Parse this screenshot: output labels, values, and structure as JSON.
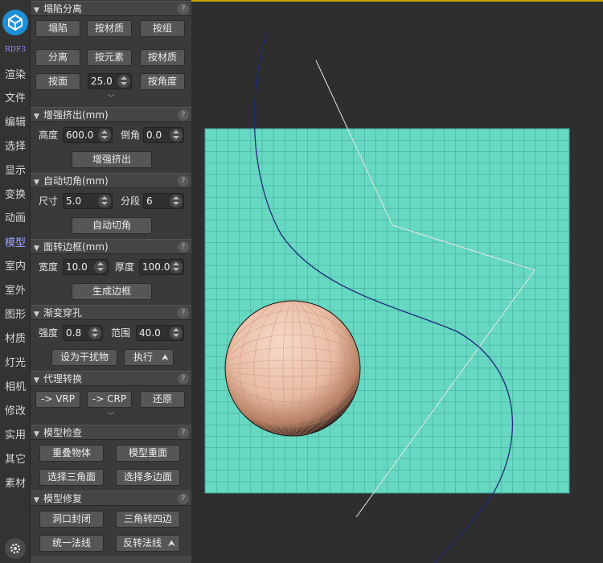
{
  "nav": {
    "brand": "RDF3",
    "items": [
      "渲染",
      "文件",
      "编辑",
      "选择",
      "显示",
      "变换",
      "动画",
      "模型",
      "室内",
      "室外",
      "图形",
      "材质",
      "灯光",
      "相机",
      "修改",
      "实用",
      "其它",
      "素材"
    ],
    "active": "模型"
  },
  "panel": {
    "collapse": {
      "title": "塌陷分离",
      "btn_collapse": "塌陷",
      "btn_by_material": "按材质",
      "btn_by_group": "按组",
      "btn_detach": "分离",
      "btn_by_element": "按元素",
      "btn_by_material2": "按材质",
      "btn_by_face": "按面",
      "angle_value": "25.0",
      "btn_by_angle": "按角度"
    },
    "extrude": {
      "title": "增强挤出(mm)",
      "height_label": "高度",
      "height_value": "600.0",
      "chamfer_label": "倒角",
      "chamfer_value": "0.0",
      "button": "增强挤出"
    },
    "autochamfer": {
      "title": "自动切角(mm)",
      "size_label": "尺寸",
      "size_value": "5.0",
      "segments_label": "分段",
      "segments_value": "6",
      "button": "自动切角"
    },
    "faceborder": {
      "title": "面转边框(mm)",
      "width_label": "宽度",
      "width_value": "10.0",
      "thickness_label": "厚度",
      "thickness_value": "100.0",
      "button": "生成边框"
    },
    "gradient_hole": {
      "title": "渐变穿孔",
      "strength_label": "强度",
      "strength_value": "0.8",
      "range_label": "范围",
      "range_value": "40.0",
      "btn_set_disturb": "设为干扰物",
      "btn_execute": "执行"
    },
    "proxy": {
      "title": "代理转换",
      "btn_vrp": "-> VRP",
      "btn_crp": "-> CRP",
      "btn_restore": "还原"
    },
    "check": {
      "title": "模型检查",
      "btn_overlap": "重叠物体",
      "btn_dup_face": "模型重面",
      "btn_sel_tri": "选择三角面",
      "btn_sel_poly": "选择多边面"
    },
    "repair": {
      "title": "模型修复",
      "btn_cap_holes": "洞口封闭",
      "btn_tri_quad": "三角转四边",
      "btn_unify_normals": "统一法线",
      "btn_flip_normals": "反转法线"
    },
    "help_glyph": "?"
  },
  "colors": {
    "grid_fill": "#67d8c1",
    "grid_line": "#3aa292",
    "curve_blue": "#1f2a7a",
    "line_white": "#e6e6e6",
    "sphere_light": "#f6d9c9",
    "sphere_mid": "#e2ac90",
    "accent_nav": "#9ea4ff",
    "logo_blue": "#1e90d8"
  }
}
